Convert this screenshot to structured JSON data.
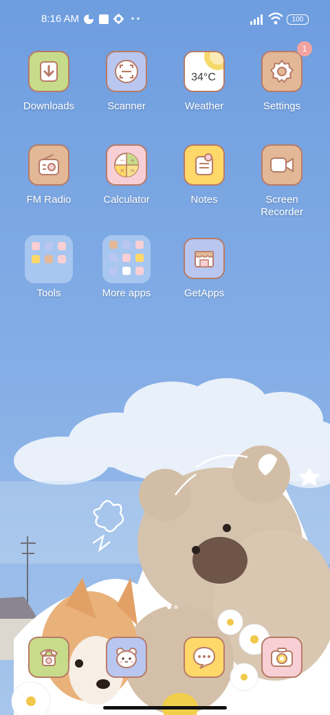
{
  "status_bar": {
    "time": "8:16 AM",
    "battery": "100",
    "icons": [
      "pie-status-icon",
      "square-status-icon",
      "gear-status-icon",
      "more-dots-icon",
      "signal-icon",
      "wifi-icon",
      "battery-icon"
    ]
  },
  "apps": {
    "downloads": {
      "label": "Downloads",
      "icon": "download-arrow"
    },
    "scanner": {
      "label": "Scanner",
      "icon": "scan-frame"
    },
    "weather": {
      "label": "Weather",
      "icon": "sun",
      "temp": "34°C"
    },
    "settings": {
      "label": "Settings",
      "icon": "gear",
      "badge": "1"
    },
    "fm_radio": {
      "label": "FM Radio",
      "icon": "radio"
    },
    "calculator": {
      "label": "Calculator",
      "icon": "calculator"
    },
    "notes": {
      "label": "Notes",
      "icon": "notepad"
    },
    "screen_recorder": {
      "label": "Screen\nRecorder",
      "line1": "Screen",
      "line2": "Recorder",
      "icon": "video-camera"
    },
    "tools": {
      "label": "Tools",
      "icon": "folder"
    },
    "more_apps": {
      "label": "More apps",
      "icon": "folder"
    },
    "getapps": {
      "label": "GetApps",
      "icon": "shop"
    }
  },
  "dock": [
    "phone-icon",
    "bear-icon",
    "message-icon",
    "camera-icon"
  ],
  "page_indicator": {
    "pages": 2,
    "current": 1
  },
  "colors": {
    "sky_top": "#6f9ee0",
    "sky_bottom": "#9cc0ea",
    "tile_border": "#b77a66",
    "green_tile": "#c7dc8a",
    "lavender_tile": "#b9c6f0",
    "cream_tile": "#f4e7a8",
    "tan_tile": "#e2b897",
    "pink_tile": "#f8cfd4",
    "yellow_tile": "#ffd86a",
    "badge": "#f2a3a0"
  }
}
